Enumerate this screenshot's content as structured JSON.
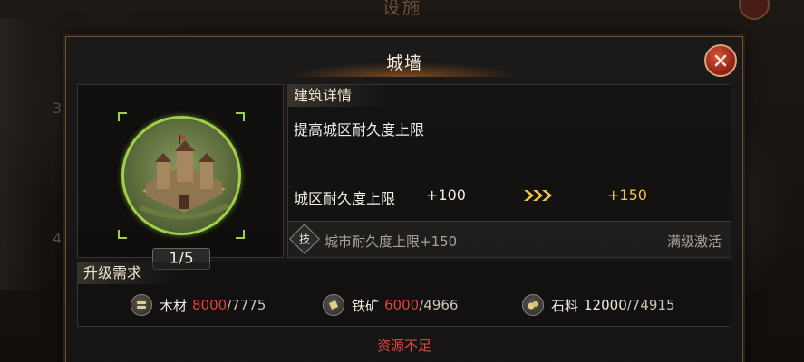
{
  "background": {
    "title": "设施",
    "side_numbers": [
      "3",
      "4"
    ]
  },
  "dialog": {
    "title": "城墙",
    "building": {
      "level_text": "1/5",
      "ring_color": "#9ed04a"
    },
    "details": {
      "header": "建筑详情",
      "description": "提高城区耐久度上限",
      "stat": {
        "label": "城区耐久度上限",
        "current": "+100",
        "next": "+150"
      },
      "tech": {
        "icon_text": "技",
        "text": "城市耐久度上限+150",
        "status": "满级激活"
      }
    },
    "requirements": {
      "header": "升级需求",
      "items": [
        {
          "name": "木材",
          "icon": "wood-icon",
          "required": "8000",
          "sep": "/",
          "owned": "7775",
          "sufficient": false
        },
        {
          "name": "铁矿",
          "icon": "iron-ore-icon",
          "required": "6000",
          "sep": "/",
          "owned": "4966",
          "sufficient": false
        },
        {
          "name": "石料",
          "icon": "stone-icon",
          "required": "12000",
          "sep": "/",
          "owned": "74915",
          "sufficient": true
        }
      ]
    },
    "warning": "资源不足"
  },
  "colors": {
    "accent_gold": "#f2c24a",
    "insufficient_red": "#d9453a",
    "close_red": "#8d1f14"
  }
}
